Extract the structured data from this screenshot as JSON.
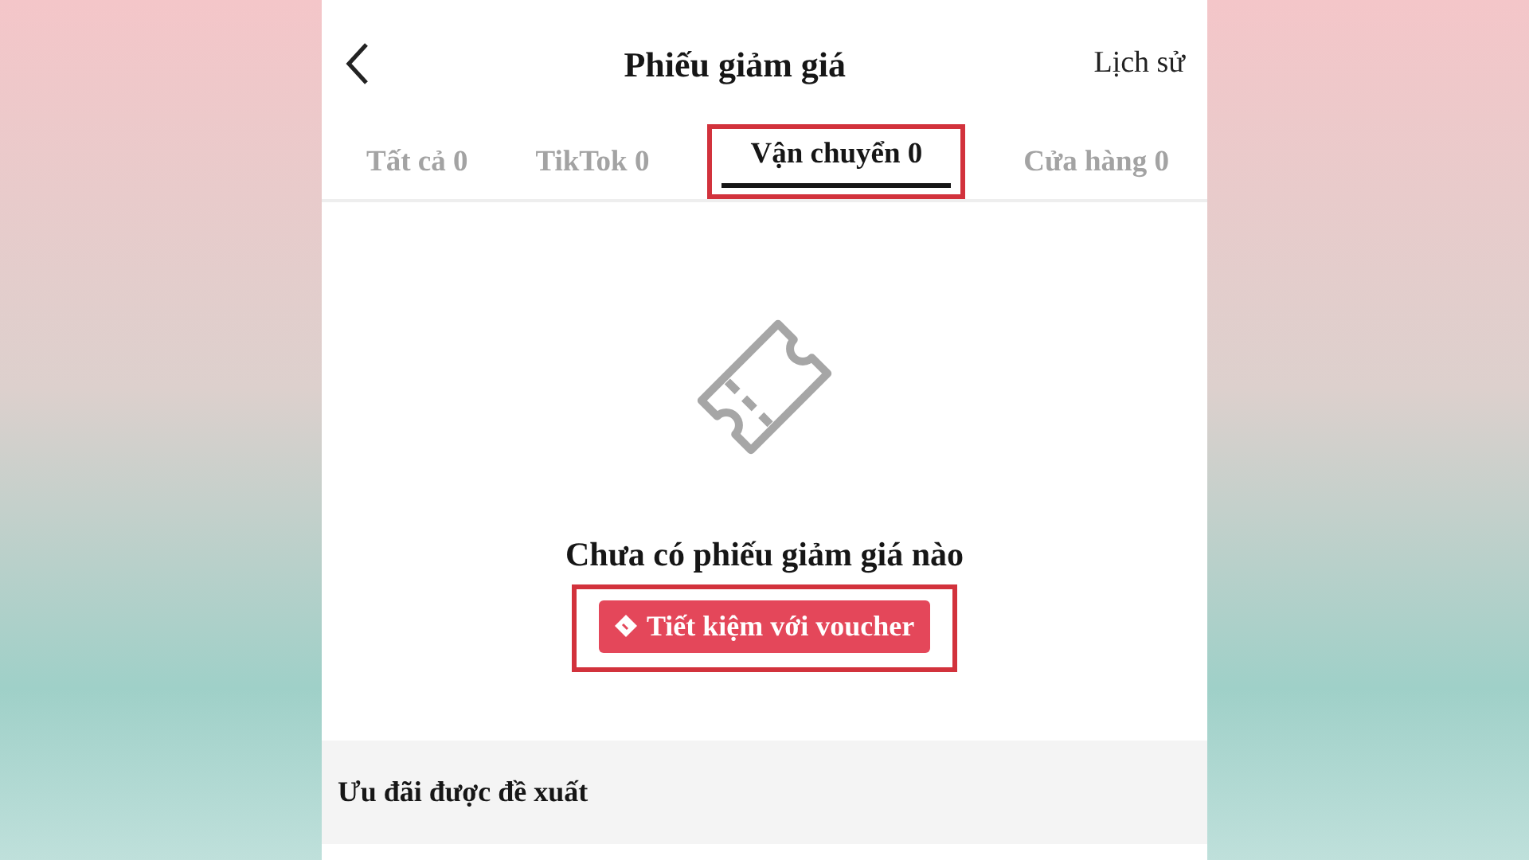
{
  "header": {
    "title": "Phiếu giảm giá",
    "history": "Lịch sử"
  },
  "tabs": [
    {
      "label": "Tất cả 0",
      "selected": false,
      "highlighted": false
    },
    {
      "label": "TikTok 0",
      "selected": false,
      "highlighted": false
    },
    {
      "label": "Vận chuyển 0",
      "selected": true,
      "highlighted": true
    },
    {
      "label": "Cửa hàng 0",
      "selected": false,
      "highlighted": false
    }
  ],
  "empty": {
    "message": "Chưa có phiếu giảm giá nào",
    "button": "Tiết kiệm với voucher",
    "button_highlighted": true
  },
  "section": {
    "title": "Ưu đãi được đề xuất"
  }
}
